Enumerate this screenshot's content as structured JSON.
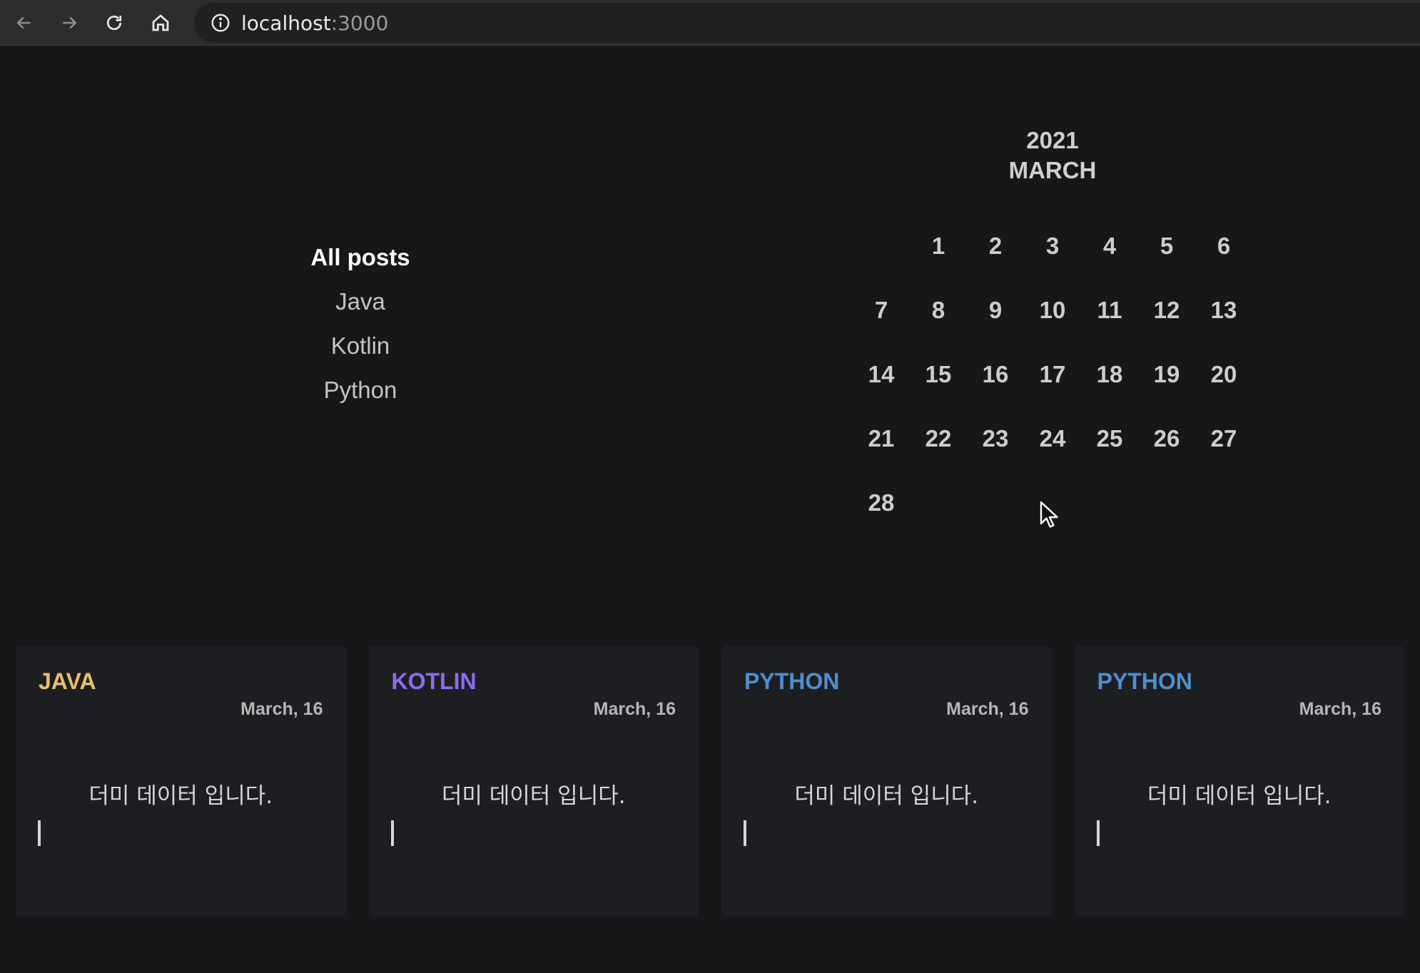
{
  "browser": {
    "url_host": "localhost",
    "url_port": ":3000"
  },
  "categories": [
    {
      "label": "All posts",
      "active": true
    },
    {
      "label": "Java",
      "active": false
    },
    {
      "label": "Kotlin",
      "active": false
    },
    {
      "label": "Python",
      "active": false
    }
  ],
  "calendar": {
    "year": "2021",
    "month": "MARCH",
    "weeks": [
      [
        "",
        "1",
        "2",
        "3",
        "4",
        "5",
        "6"
      ],
      [
        "7",
        "8",
        "9",
        "10",
        "11",
        "12",
        "13"
      ],
      [
        "14",
        "15",
        "16",
        "17",
        "18",
        "19",
        "20"
      ],
      [
        "21",
        "22",
        "23",
        "24",
        "25",
        "26",
        "27"
      ],
      [
        "28",
        "",
        "",
        "",
        "",
        "",
        ""
      ]
    ]
  },
  "posts": [
    {
      "tag": "JAVA",
      "tag_color": "#e6c16b",
      "date": "March, 16",
      "body": "더미 데이터 입니다."
    },
    {
      "tag": "KOTLIN",
      "tag_color": "#8c6cf0",
      "date": "March, 16",
      "body": "더미 데이터 입니다."
    },
    {
      "tag": "PYTHON",
      "tag_color": "#4f8fcf",
      "date": "March, 16",
      "body": "더미 데이터 입니다."
    },
    {
      "tag": "PYTHON",
      "tag_color": "#4f8fcf",
      "date": "March, 16",
      "body": "더미 데이터 입니다."
    }
  ]
}
